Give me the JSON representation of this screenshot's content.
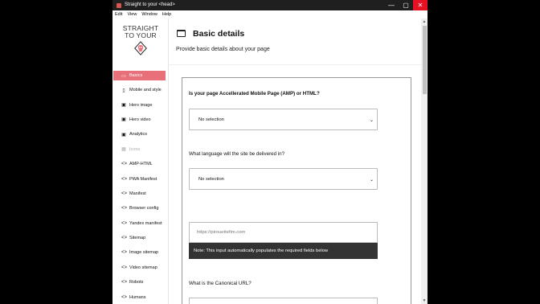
{
  "window": {
    "title": "Straight to your <head>",
    "minimize": "—",
    "maximize": "▢",
    "close": "✕"
  },
  "menu": [
    "Edit",
    "View",
    "Window",
    "Help"
  ],
  "logo": {
    "line1": "STRAIGHT",
    "line2": "TO YOUR"
  },
  "nav": [
    {
      "label": "Basics",
      "icon": "window-icon",
      "glyph": "▭",
      "active": true
    },
    {
      "label": "Mobile and style",
      "icon": "phone-icon",
      "glyph": "▯"
    },
    {
      "label": "Hero image",
      "icon": "image-icon",
      "glyph": "▣"
    },
    {
      "label": "Hero video",
      "icon": "video-icon",
      "glyph": "▣"
    },
    {
      "label": "Analytics",
      "icon": "analytics-icon",
      "glyph": "▣"
    },
    {
      "label": "Icons",
      "icon": "grid-icon",
      "glyph": "▦",
      "disabled": true
    },
    {
      "label": "AMP-HTML",
      "icon": "code-icon",
      "glyph": "<>"
    },
    {
      "label": "PWA Manifest",
      "icon": "code-icon",
      "glyph": "<>"
    },
    {
      "label": "Manifest",
      "icon": "code-icon",
      "glyph": "<>"
    },
    {
      "label": "Browser config",
      "icon": "code-icon",
      "glyph": "<>"
    },
    {
      "label": "Yandex manifest",
      "icon": "code-icon",
      "glyph": "<>"
    },
    {
      "label": "Sitemap",
      "icon": "code-icon",
      "glyph": "<>"
    },
    {
      "label": "Image sitemap",
      "icon": "code-icon",
      "glyph": "<>"
    },
    {
      "label": "Video sitemap",
      "icon": "code-icon",
      "glyph": "<>"
    },
    {
      "label": "Robots",
      "icon": "code-icon",
      "glyph": "<>"
    },
    {
      "label": "Humans",
      "icon": "code-icon",
      "glyph": "<>"
    }
  ],
  "main": {
    "title": "Basic details",
    "subtitle": "Provide basic details about your page",
    "q_amp": "Is your page Accellerated Mobile Page (AMP) or HTML?",
    "q_amp_value": "No selection",
    "q_lang": "What language will the site be delivered in?",
    "q_lang_value": "No selection",
    "url_placeholder": "https://pirouettefim.com",
    "note": "Note: This input automatically populates the required fields below",
    "q_canonical": "What is the Canonical URL?"
  },
  "colors": {
    "accent": "#e8707a",
    "titlebar": "#1f1f1f",
    "close": "#e81123"
  }
}
